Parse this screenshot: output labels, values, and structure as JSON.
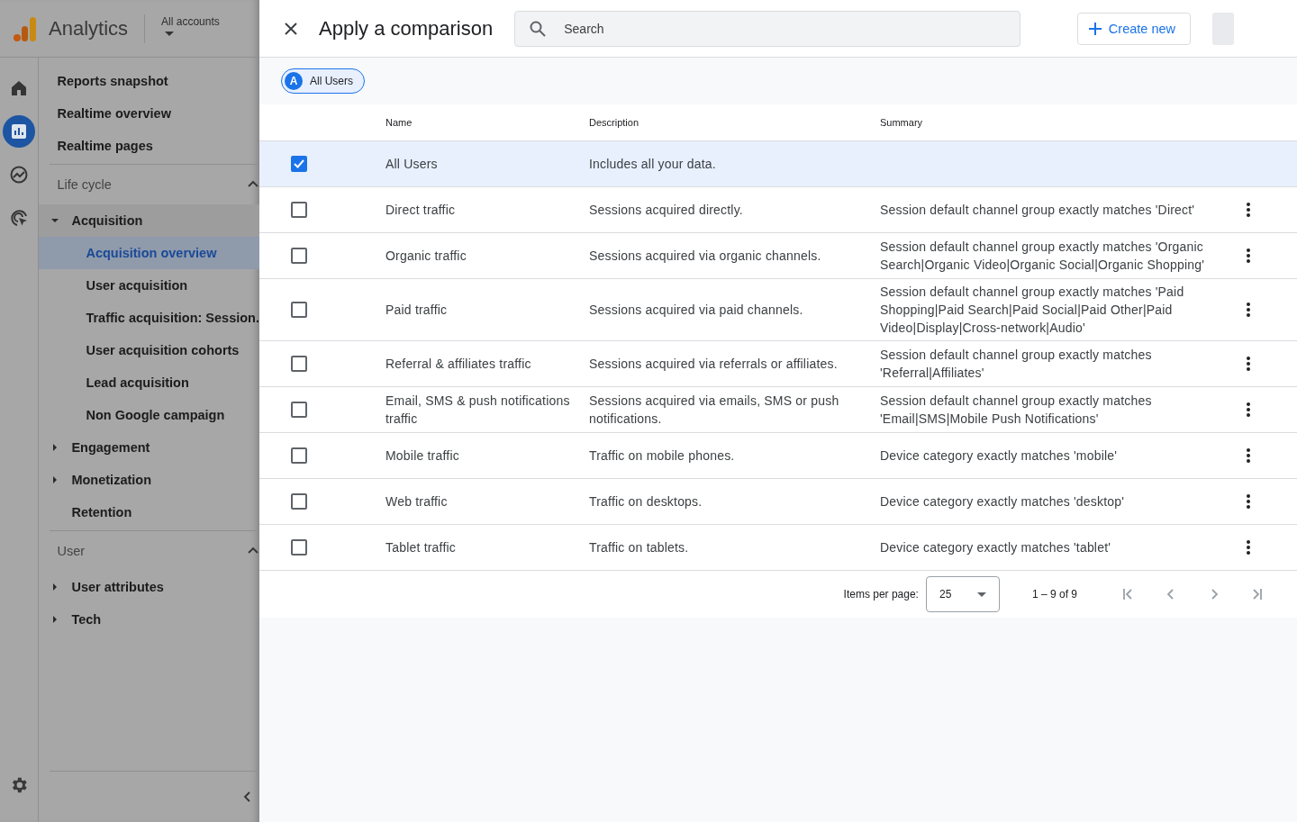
{
  "app": {
    "name": "Analytics",
    "account_label": "All accounts"
  },
  "rail": [
    {
      "kind": "home",
      "selected": false
    },
    {
      "kind": "reports",
      "selected": true
    },
    {
      "kind": "explore",
      "selected": false
    },
    {
      "kind": "advertising",
      "selected": false
    }
  ],
  "nav": {
    "top_items": [
      "Reports snapshot",
      "Realtime overview",
      "Realtime pages"
    ],
    "sections": [
      {
        "title": "Life cycle",
        "expanded": true,
        "items": [
          {
            "label": "Acquisition",
            "kind": "group",
            "expanded": true,
            "children": [
              {
                "label": "Acquisition overview",
                "selected": true
              },
              {
                "label": "User acquisition",
                "selected": false
              },
              {
                "label": "Traffic acquisition: Session.",
                "selected": false
              },
              {
                "label": "User acquisition cohorts",
                "selected": false
              },
              {
                "label": "Lead acquisition",
                "selected": false
              },
              {
                "label": "Non Google campaign",
                "selected": false
              }
            ]
          },
          {
            "label": "Engagement",
            "kind": "group",
            "expanded": false
          },
          {
            "label": "Monetization",
            "kind": "group",
            "expanded": false
          },
          {
            "label": "Retention",
            "kind": "link"
          }
        ]
      },
      {
        "title": "User",
        "expanded": true,
        "items": [
          {
            "label": "User attributes",
            "kind": "group",
            "expanded": false
          },
          {
            "label": "Tech",
            "kind": "group",
            "expanded": false
          }
        ]
      }
    ]
  },
  "panel": {
    "title": "Apply a comparison",
    "search": {
      "placeholder": "Search"
    },
    "create_button": "Create new",
    "chips": [
      {
        "letter": "A",
        "label": "All Users"
      }
    ],
    "table": {
      "columns": [
        "Name",
        "Description",
        "Summary"
      ],
      "rows": [
        {
          "checked": true,
          "name": "All Users",
          "description": "Includes all your data.",
          "summary": ""
        },
        {
          "checked": false,
          "name": "Direct traffic",
          "description": "Sessions acquired directly.",
          "summary": "Session default channel group exactly matches 'Direct'"
        },
        {
          "checked": false,
          "name": "Organic traffic",
          "description": "Sessions acquired via organic channels.",
          "summary": "Session default channel group exactly matches 'Organic Search|Organic Video|Organic Social|Organic Shopping'"
        },
        {
          "checked": false,
          "name": "Paid traffic",
          "description": "Sessions acquired via paid channels.",
          "summary": "Session default channel group exactly matches 'Paid Shopping|Paid Search|Paid Social|Paid Other|Paid Video|Display|Cross-network|Audio'"
        },
        {
          "checked": false,
          "name": "Referral & affiliates traffic",
          "description": "Sessions acquired via referrals or affiliates.",
          "summary": "Session default channel group exactly matches 'Referral|Affiliates'"
        },
        {
          "checked": false,
          "name": "Email, SMS & push notifications traffic",
          "description": "Sessions acquired via emails, SMS or push notifications.",
          "summary": "Session default channel group exactly matches 'Email|SMS|Mobile Push Notifications'"
        },
        {
          "checked": false,
          "name": "Mobile traffic",
          "description": "Traffic on mobile phones.",
          "summary": "Device category exactly matches 'mobile'"
        },
        {
          "checked": false,
          "name": "Web traffic",
          "description": "Traffic on desktops.",
          "summary": "Device category exactly matches 'desktop'"
        },
        {
          "checked": false,
          "name": "Tablet traffic",
          "description": "Traffic on tablets.",
          "summary": "Device category exactly matches 'tablet'"
        }
      ]
    },
    "pagination": {
      "label": "Items per page:",
      "page_size": "25",
      "range": "1 – 9 of 9"
    }
  }
}
